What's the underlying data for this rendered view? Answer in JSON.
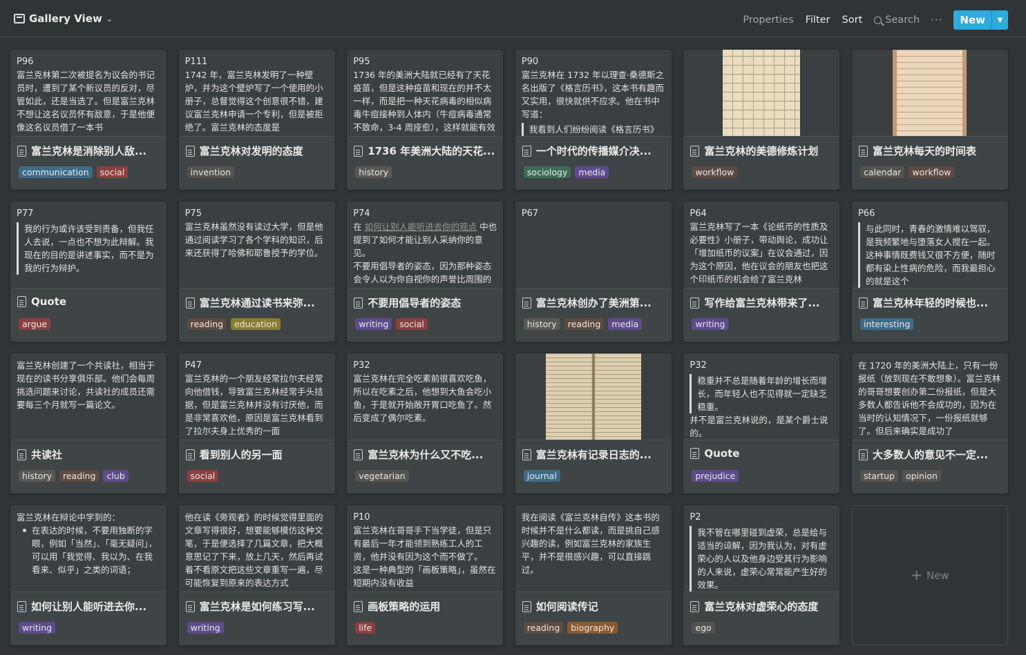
{
  "toolbar": {
    "view_name": "Gallery View",
    "properties": "Properties",
    "filter": "Filter",
    "sort": "Sort",
    "search": "Search",
    "more": "···",
    "new": "New"
  },
  "colors": {
    "background": "#2f3437",
    "card": "#3f4447",
    "accent": "#2eaadc"
  },
  "tag_colors": {
    "communication": "#3d6b87",
    "social": "#8c3f3f",
    "invention": "#55534e",
    "history": "#5a5855",
    "sociology": "#3a6d55",
    "media": "#5d4b8c",
    "workflow": "#5e4a40",
    "calendar": "#55534e",
    "argue": "#8c3f3f",
    "reading": "#5e4a40",
    "education": "#8a7d2e",
    "writing": "#5d4b8c",
    "interesting": "#3d6b87",
    "club": "#5d4b8c",
    "vegetarian": "#55534e",
    "journal": "#3d6b87",
    "prejudice": "#5d4b8c",
    "startup": "#55534e",
    "opinion": "#55534e",
    "life": "#8c3f3f",
    "biography": "#8a5a2e",
    "ego": "#55534e"
  },
  "cards": [
    {
      "pid": "P96",
      "lines": [
        "富兰克林第二次被提名为议会的书记员时，遭到了某个新议员的反对，尽管如此，还是当选了。但是富兰克林不想让这名议员怀有敌意，于是他便像这名议员借了一本书"
      ],
      "title": "富兰克林是消除别人敌...",
      "tags": [
        "communication",
        "social"
      ]
    },
    {
      "pid": "P111",
      "lines": [
        "1742 年，富兰克林发明了一种壁炉，并为这个壁炉写了一个使用的小册子，总督觉得这个创意很不错，建议富兰克林申请一个专利，但是被拒绝了。富兰克林的态度是"
      ],
      "title": "富兰克林对发明的态度",
      "tags": [
        "invention"
      ]
    },
    {
      "pid": "P95",
      "lines": [
        "1736 年的美洲大陆就已经有了天花疫苗，但是这种疫苗和现在的并不太一样，而是把一种天花病毒的相似病毒牛痘接种到人体内（牛痘病毒通常不致命，3-4 周痊愈），这样就能有效预防天花"
      ],
      "title": "1736 年美洲大陆的天花...",
      "tags": [
        "history"
      ]
    },
    {
      "pid": "P90",
      "lines": [
        "富兰克林在 1732 年以理查·桑德斯之名出版了《格言历书》，这本书有趣而又实用，很快就供不应求。他在书中写道："
      ],
      "quote": "我看到人们纷纷阅读《格言历书》",
      "title": "一个时代的传播媒介决...",
      "tags": [
        "sociology",
        "media"
      ]
    },
    {
      "image": "paper1",
      "title": "富兰克林的美德修炼计划",
      "tags": [
        "workflow"
      ]
    },
    {
      "image": "paper2",
      "title": "富兰克林每天的时间表",
      "tags": [
        "calendar",
        "workflow"
      ]
    },
    {
      "pid": "P77",
      "quote": "我的行为或许该受到责备，但我任人去说，一点也不想为此辩解。我现在的目的是讲述事实，而不是为我的行为辩护。",
      "title": "Quote",
      "tags": [
        "argue"
      ]
    },
    {
      "pid": "P75",
      "lines": [
        "富兰克林虽然没有读过大学，但是他通过阅读学习了各个学科的知识，后来还获得了哈佛和耶鲁授予的学位。"
      ],
      "title": "富兰克林通过读书来弥...",
      "tags": [
        "reading",
        "education"
      ]
    },
    {
      "pid": "P74",
      "mixed": true,
      "pre": "在 ",
      "link": "如何让别人能听进去你的观点",
      "post": " 中也提到了如何才能让别人采纳你的意见。",
      "lines2": [
        "不要用倡导者的姿态，因为那种姿态会令人以为你自视你的声誉比周围的人高"
      ],
      "title": "不要用倡导者的姿态",
      "tags": [
        "writing",
        "social"
      ]
    },
    {
      "pid": "P67",
      "lines": [],
      "title": "富兰克林创办了美洲第...",
      "tags": [
        "history",
        "reading",
        "media"
      ]
    },
    {
      "pid": "P64",
      "lines": [
        "富兰克林写了一本《论纸币的性质及必要性》小册子，带动舆论，成功让「增加纸币的议案」在议会通过，因为这个原因，他在议会的朋友也把这个印纸币的机会给了富兰克林"
      ],
      "title": "写作给富兰克林带来了...",
      "tags": [
        "writing"
      ]
    },
    {
      "pid": "P66",
      "quote": "与此同时，青春的激情难以驾驭，是我频繁地与堕落女人搅在一起。这种事情既费钱又很不方便，随时都有染上性病的危险，而我最担心的就是这个",
      "title": "富兰克林年轻的时候也...",
      "tags": [
        "interesting"
      ]
    },
    {
      "lines": [
        "富兰克林创建了一个共读社，相当于现在的读书分享俱乐部。他们会每周挑选问题来讨论，共读社的成员还需要每三个月就写一篇论文。"
      ],
      "title": "共读社",
      "tags": [
        "history",
        "reading",
        "club"
      ]
    },
    {
      "pid": "P47",
      "lines": [
        "富兰克林的一个朋友经常拉尔夫经常向他借钱，导致富兰克林经常手头拮据，但是富兰克林并没有讨厌他，而是非常喜欢他，原因是富兰克林看到了拉尔夫身上优秀的一面"
      ],
      "title": "看到别人的另一面",
      "tags": [
        "social"
      ]
    },
    {
      "pid": "P32",
      "lines": [
        "富兰克林在完全吃素前很喜欢吃鱼，所以在吃素之后，他想到大鱼会吃小鱼，于是就开始敞开胃口吃鱼了。然后变成了偶尔吃素。"
      ],
      "title": "富兰克林为什么又不吃...",
      "tags": [
        "vegetarian"
      ]
    },
    {
      "image": "paper3",
      "title": "富兰克林有记录日志的...",
      "tags": [
        "journal"
      ]
    },
    {
      "pid": "P32",
      "quote": "稳重并不总是随着年龄的增长而增长，而年轻人也不见得就一定缺乏稳重。",
      "lines2": [
        "并不是富兰克林说的，是某个爵士说的。"
      ],
      "title": "Quote",
      "tags": [
        "prejudice"
      ]
    },
    {
      "lines": [
        "在 1720 年的美洲大陆上，只有一份报纸（放到现在不敢想象）。富兰克林的哥哥想要创办第二份报纸，但是大多数人都告诉他不会成功的，因为在当时的认知情况下，一份报纸就够了。但后来确实是成功了"
      ],
      "title": "大多数人的意见不一定...",
      "tags": [
        "startup",
        "opinion"
      ]
    },
    {
      "lines": [
        "富兰克林在辩论中学到的："
      ],
      "bullet": "在表达的时候，不要用独断的字眼，例如「当然」、「毫无疑问」，可以用「我觉得、我以为、在我看来、似乎」之类的词语；",
      "title": "如何让别人能听进去你...",
      "tags": [
        "writing"
      ]
    },
    {
      "lines": [
        "他在读《旁观者》的时候觉得里面的文章写得很好，想要能够模仿这种文笔，于是便选择了几篇文章，把大概意思记了下来，放上几天，然后再试着不看原文把这些文章重写一遍，尽可能恢复到原来的表达方式"
      ],
      "title": "富兰克林是如何练习写...",
      "tags": [
        "writing"
      ]
    },
    {
      "pid": "P10",
      "lines": [
        "富兰克林在哥哥手下当学徒，但是只有最后一年才能领到熟练工人的工资，他并没有因为这个而不做了。",
        "这是一种典型的「画板策略」，虽然在短期内没有收益"
      ],
      "title": "画板策略的运用",
      "tags": [
        "life"
      ]
    },
    {
      "lines": [
        "我在阅读《富兰克林自传》这本书的时候并不是什么都读，而是挑自己感兴趣的读，例如富兰克林的家族生平，并不是很感兴趣，可以直接跳过。"
      ],
      "title": "如何阅读传记",
      "tags": [
        "reading",
        "biography"
      ]
    },
    {
      "pid": "P2",
      "quote": "我不管在哪里碰到虚荣，总是给与适当的谅解，因为我认为，对有虚荣心的人以及他身边受其行为影响的人来说，虚荣心常常能产生好的效果。",
      "title": "富兰克林对虚荣心的态度",
      "tags": [
        "ego"
      ]
    }
  ],
  "new_card": {
    "label": "New"
  }
}
